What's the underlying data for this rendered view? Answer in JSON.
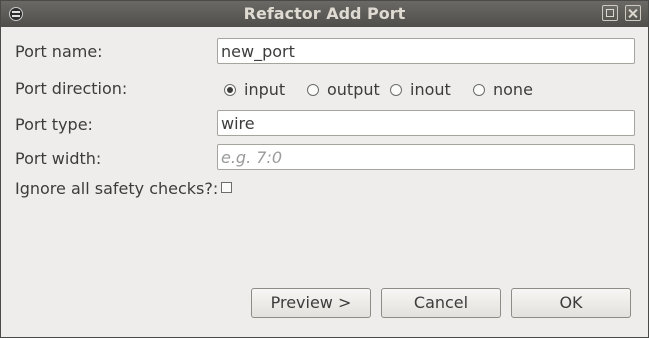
{
  "window": {
    "title": "Refactor Add Port",
    "controls": [
      "maximize-icon",
      "close-icon"
    ]
  },
  "form": {
    "port_name": {
      "label": "Port name:",
      "value": "new_port"
    },
    "port_direction": {
      "label": "Port direction:",
      "options": [
        {
          "label": "input",
          "checked": true
        },
        {
          "label": "output",
          "checked": false
        },
        {
          "label": "inout",
          "checked": false
        },
        {
          "label": "none",
          "checked": false
        }
      ]
    },
    "port_type": {
      "label": "Port type:",
      "value": "wire"
    },
    "port_width": {
      "label": "Port width:",
      "value": "",
      "placeholder": "e.g. 7:0"
    },
    "ignore_checks": {
      "label": "Ignore all safety checks?:",
      "checked": false
    }
  },
  "buttons": {
    "preview": "Preview >",
    "cancel": "Cancel",
    "ok": "OK"
  }
}
